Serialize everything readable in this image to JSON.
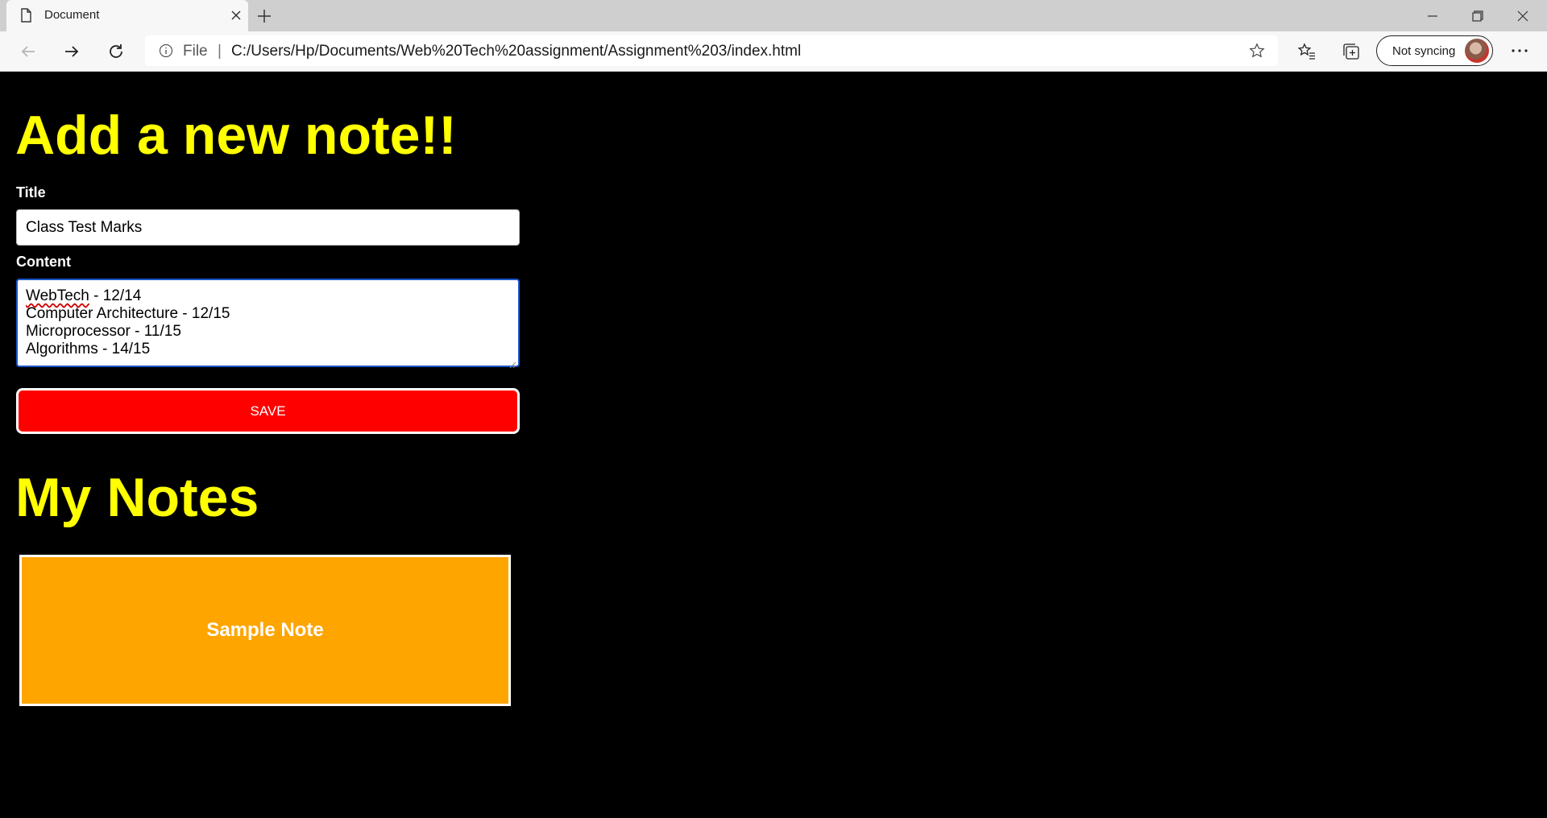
{
  "browser": {
    "tab_title": "Document",
    "address_scheme": "File",
    "address_separator": "|",
    "url": "C:/Users/Hp/Documents/Web%20Tech%20assignment/Assignment%203/index.html",
    "sync_label": "Not syncing",
    "more_label": "···"
  },
  "form": {
    "heading": "Add a new note!!",
    "title_label": "Title",
    "title_value": "Class Test Marks",
    "content_label": "Content",
    "content_lines": [
      {
        "spell": "WebTech",
        "rest": " - 12/14"
      },
      {
        "text": "Computer Architecture - 12/15"
      },
      {
        "text": "Microprocessor - 11/15"
      },
      {
        "text": "Algorithms - 14/15"
      }
    ],
    "save_label": "SAVE"
  },
  "notes": {
    "heading": "My Notes",
    "items": [
      {
        "title": "Sample Note"
      }
    ]
  },
  "colors": {
    "background": "#000000",
    "heading": "#ffff00",
    "save_button": "#ff0000",
    "note_card": "#ffa500"
  }
}
